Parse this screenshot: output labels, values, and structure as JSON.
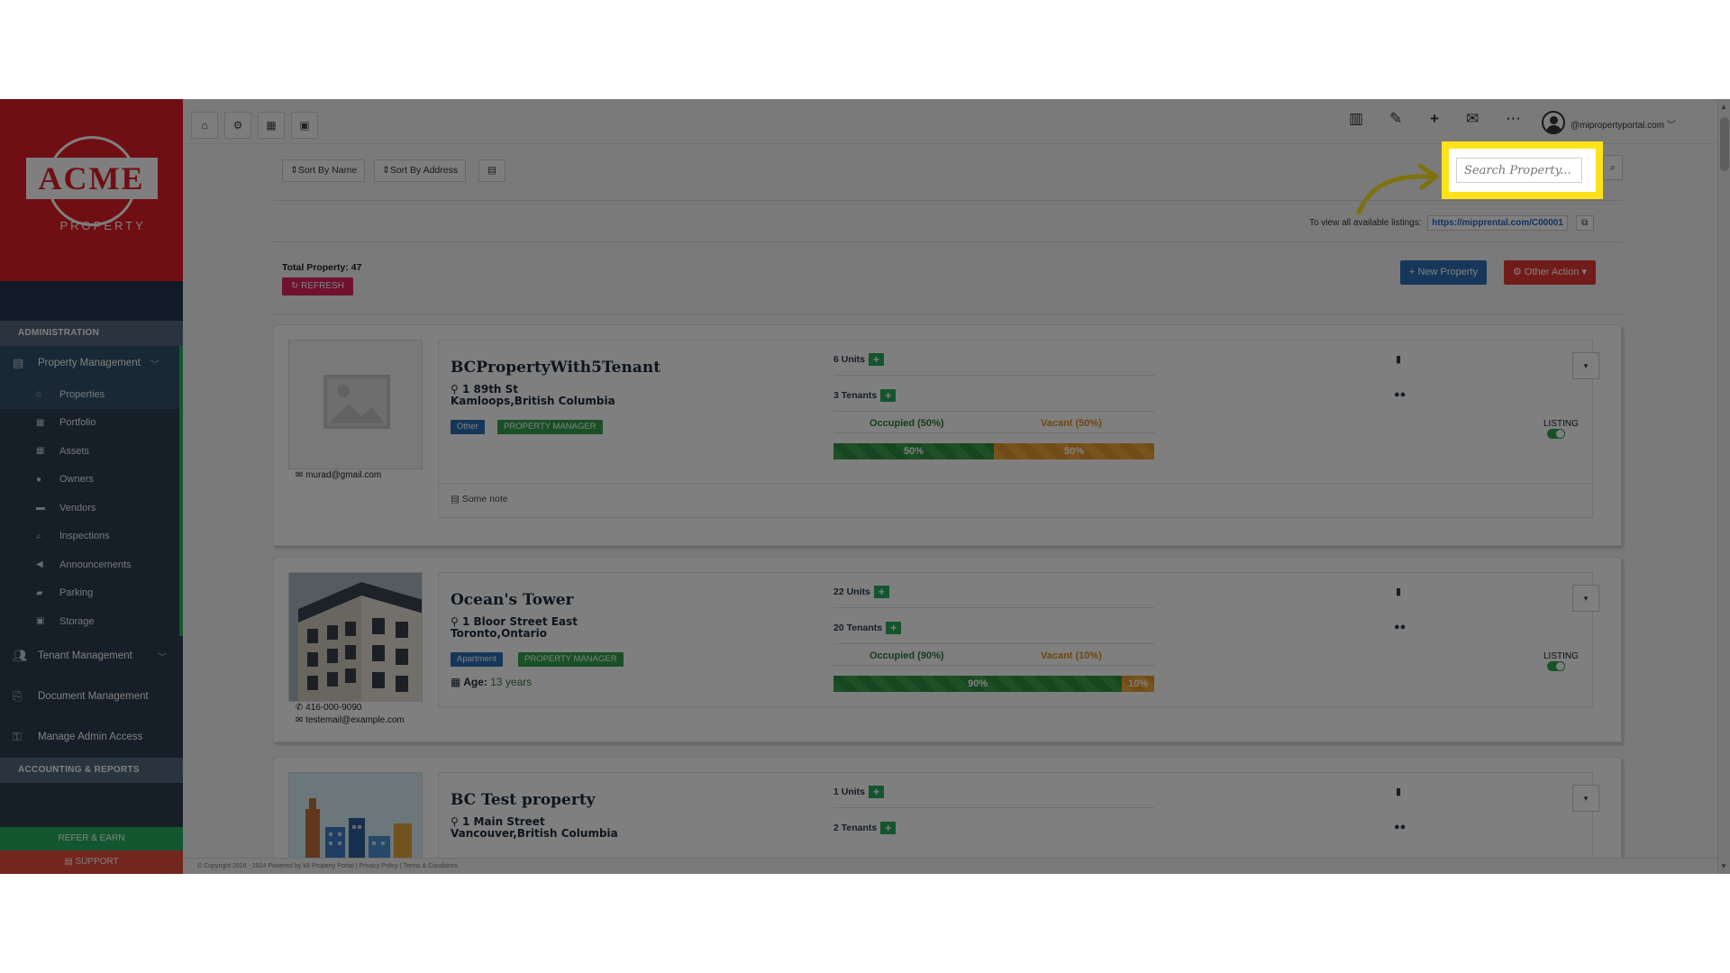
{
  "brand": {
    "name": "ACME",
    "tagline": "PROPERTY",
    "color": "#e01f26"
  },
  "sidebar": {
    "section1": "ADMINISTRATION",
    "group_property": "Property Management",
    "items": [
      {
        "label": "Properties",
        "icon": "home-icon"
      },
      {
        "label": "Portfolio",
        "icon": "building-icon"
      },
      {
        "label": "Assets",
        "icon": "table-icon"
      },
      {
        "label": "Owners",
        "icon": "user-icon"
      },
      {
        "label": "Vendors",
        "icon": "truck-icon"
      },
      {
        "label": "Inspections",
        "icon": "search-icon"
      },
      {
        "label": "Announcements",
        "icon": "megaphone-icon"
      },
      {
        "label": "Parking",
        "icon": "car-icon"
      },
      {
        "label": "Storage",
        "icon": "archive-icon"
      }
    ],
    "group_tenant": "Tenant Management",
    "group_document": "Document Management",
    "group_admin": "Manage Admin Access",
    "section2": "ACCOUNTING & REPORTS",
    "refer": "REFER & EARN",
    "support": "SUPPORT"
  },
  "topbar": {
    "email": "@mipropertyportal.com"
  },
  "toolbar": {
    "sort_name": "Sort By Name",
    "sort_address": "Sort By Address",
    "search_placeholder": "Search Property...",
    "listings_label": "To view all available listings:",
    "listings_link": "https://mipprental.com/C00001"
  },
  "summary": {
    "total": "Total Property: 47",
    "refresh": "REFRESH",
    "new_property": "New Property",
    "other_action": "Other Action"
  },
  "properties": [
    {
      "name": "BCPropertyWith5Tenant",
      "address1": "1 89th St",
      "address2": "Kamloops,British Columbia",
      "type": "Other",
      "role": "PROPERTY MANAGER",
      "units": "6 Units",
      "tenants": "3 Tenants",
      "occupied_label": "Occupied (50%)",
      "vacant_label": "Vacant (50%)",
      "occupied_pct": 50,
      "occupied_text": "50%",
      "vacant_text": "50%",
      "email": "murad@gmail.com",
      "note": "Some note",
      "listing": "LISTING"
    },
    {
      "name": "Ocean's Tower",
      "address1": "1 Bloor Street East",
      "address2": "Toronto,Ontario",
      "type": "Apartment",
      "role": "PROPERTY MANAGER",
      "units": "22 Units",
      "tenants": "20 Tenants",
      "occupied_label": "Occupied (90%)",
      "vacant_label": "Vacant (10%)",
      "occupied_pct": 90,
      "occupied_text": "90%",
      "vacant_text": "10%",
      "age_label": "Age:",
      "age_value": "13 years",
      "phone": "416-000-9090",
      "email": "testemail@example.com",
      "listing": "LISTING"
    },
    {
      "name": "BC Test property",
      "address1": "1 Main Street",
      "address2": "Vancouver,British Columbia",
      "units": "1 Units",
      "tenants": "2 Tenants"
    }
  ],
  "footer": "© Copyright 2016 - 2024 Powered by MI Property Portal | Privacy Policy | Terms & Conditions"
}
